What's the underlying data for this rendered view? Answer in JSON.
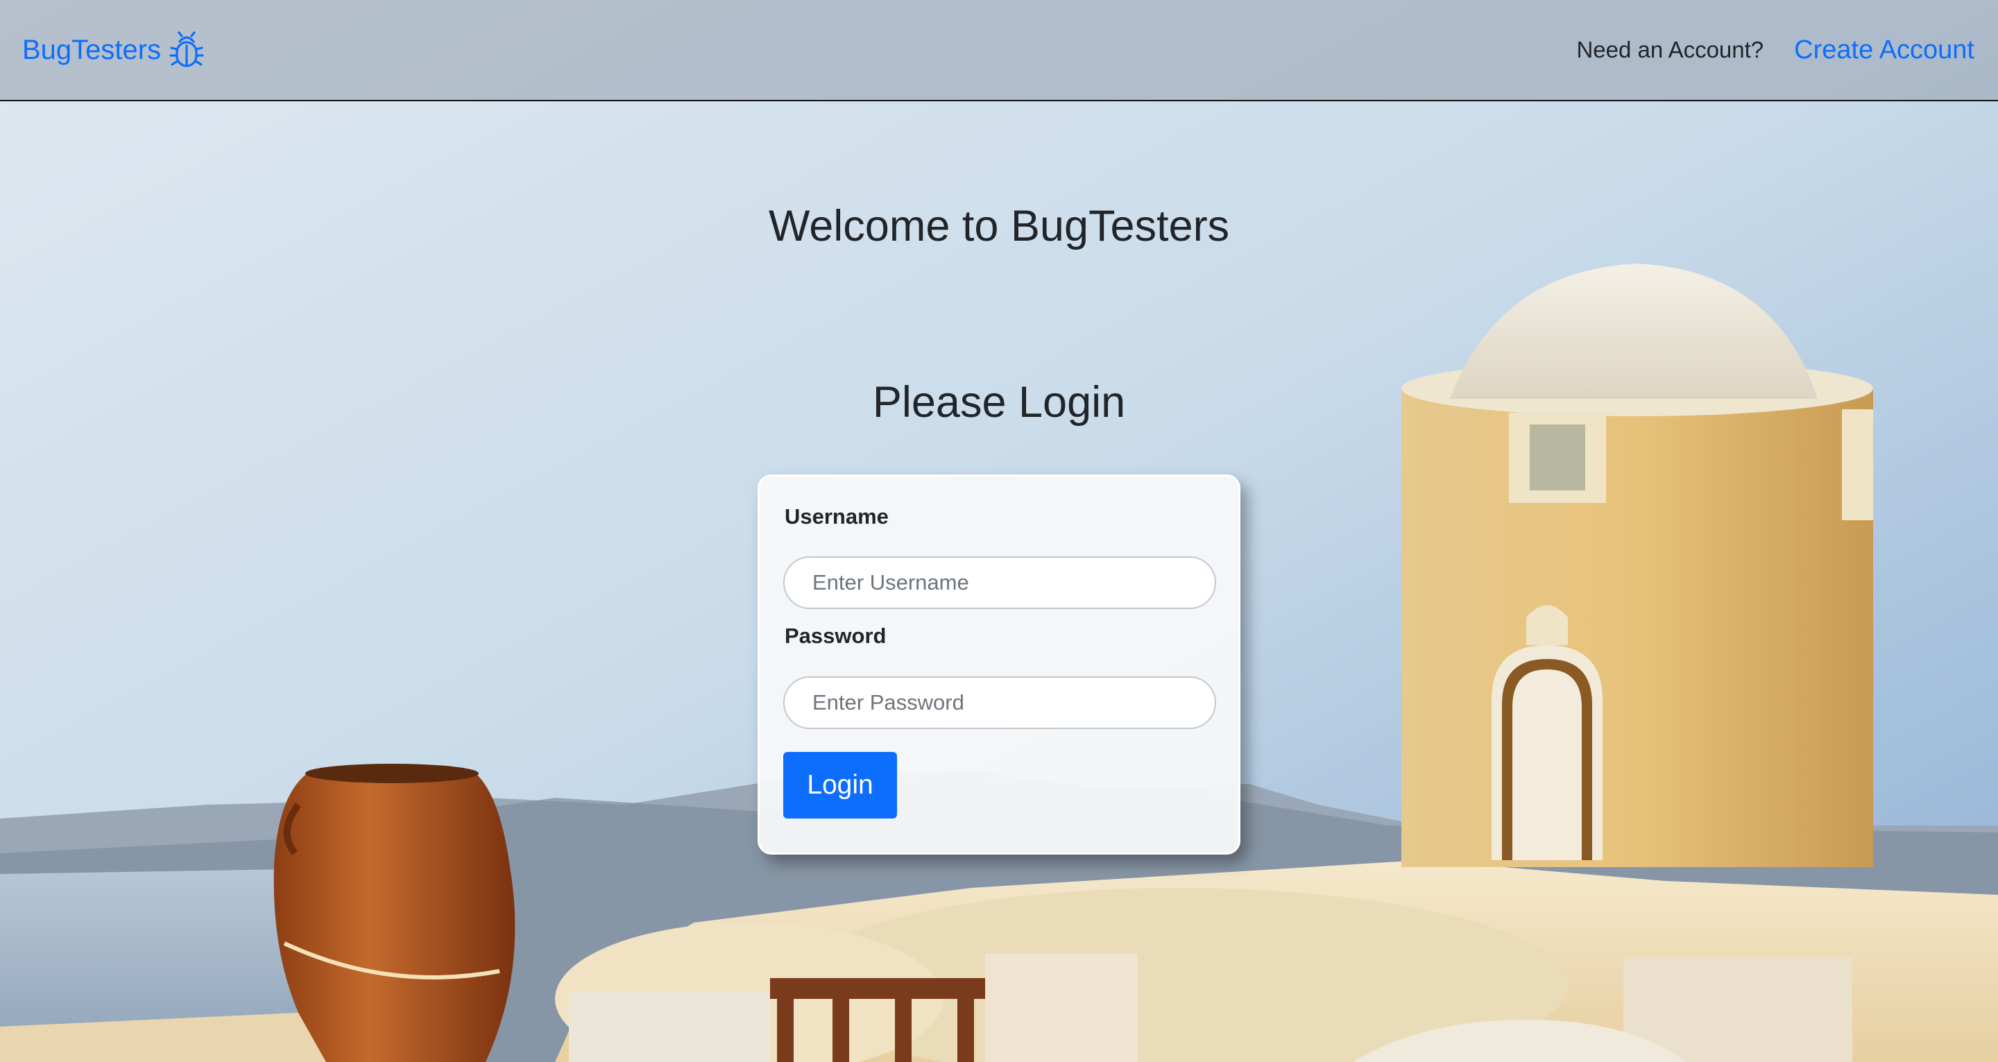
{
  "navbar": {
    "brand": "BugTesters",
    "brand_icon": "bug-icon",
    "question": "Need an Account?",
    "create_link": "Create Account"
  },
  "main": {
    "welcome": "Welcome to BugTesters",
    "login_heading": "Please Login"
  },
  "form": {
    "username_label": "Username",
    "username_placeholder": "Enter Username",
    "username_value": "",
    "password_label": "Password",
    "password_placeholder": "Enter Password",
    "password_value": "",
    "login_button": "Login"
  },
  "colors": {
    "accent": "#0d6efd",
    "text": "#212529"
  }
}
